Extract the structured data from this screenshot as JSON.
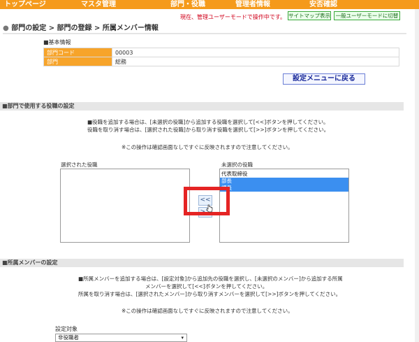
{
  "nav": {
    "items": [
      "トップページ",
      "マスタ管理",
      "部門・役職",
      "管理者情報",
      "安否確認"
    ]
  },
  "mode": {
    "status_text": "現在、管理ユーザーモードで操作中です。",
    "sitemap_label": "サイトマップ表示",
    "switch_label": "一般ユーザーモードに切替"
  },
  "breadcrumb": {
    "bullet": "●",
    "text": "部門の設定 > 部門の登録 > 所属メンバー情報"
  },
  "basic_info": {
    "title": "■基本情報",
    "rows": [
      {
        "label": "部門コード",
        "value": "00003"
      },
      {
        "label": "部門",
        "value": "総務"
      }
    ],
    "back_button": "設定メニューに戻る"
  },
  "roles_section": {
    "title": "■部門で使用する役職の設定",
    "instruction_1": "■役職を追加する場合は、[未選択の役職]から追加する役職を選択して[<<]ボタンを押してください。",
    "instruction_2": "役職を取り消す場合は、[選択された役職]から取り消す役職を選択して[>>]ボタンを押してください。",
    "note": "※この操作は確認画面なしですぐに反映されますので注意してください。",
    "selected_label": "選択された役職",
    "unselected_label": "未選択の役職",
    "unselected_options": [
      {
        "text": "代表取締役",
        "selected": false
      },
      {
        "text": "部長",
        "selected": true
      },
      {
        "text": "課長",
        "selected": true
      }
    ],
    "add_button": "<<",
    "remove_button": ">>"
  },
  "members_section": {
    "title": "■所属メンバーの設定",
    "instruction_1": "■所属メンバーを追加する場合は、[設定対象]から追加先の役職を選択し、[未選択のメンバー]から追加する所属",
    "instruction_2": "メンバーを選択して[<<]ボタンを押してください。",
    "instruction_3": "所属を取り消す場合は、[選択されたメンバー]から取り消すメンバーを選択して[>>]ボタンを押してください。",
    "note": "※この操作は確認画面なしですぐに反映されますので注意してください。",
    "target_label": "設定対象",
    "target_value": "非役職者",
    "caret": "▾"
  },
  "colors": {
    "nav": "#f59a1b",
    "label_cell": "#f7a42a",
    "highlight": "#e52424",
    "selected_option": "#3b8ff0"
  }
}
